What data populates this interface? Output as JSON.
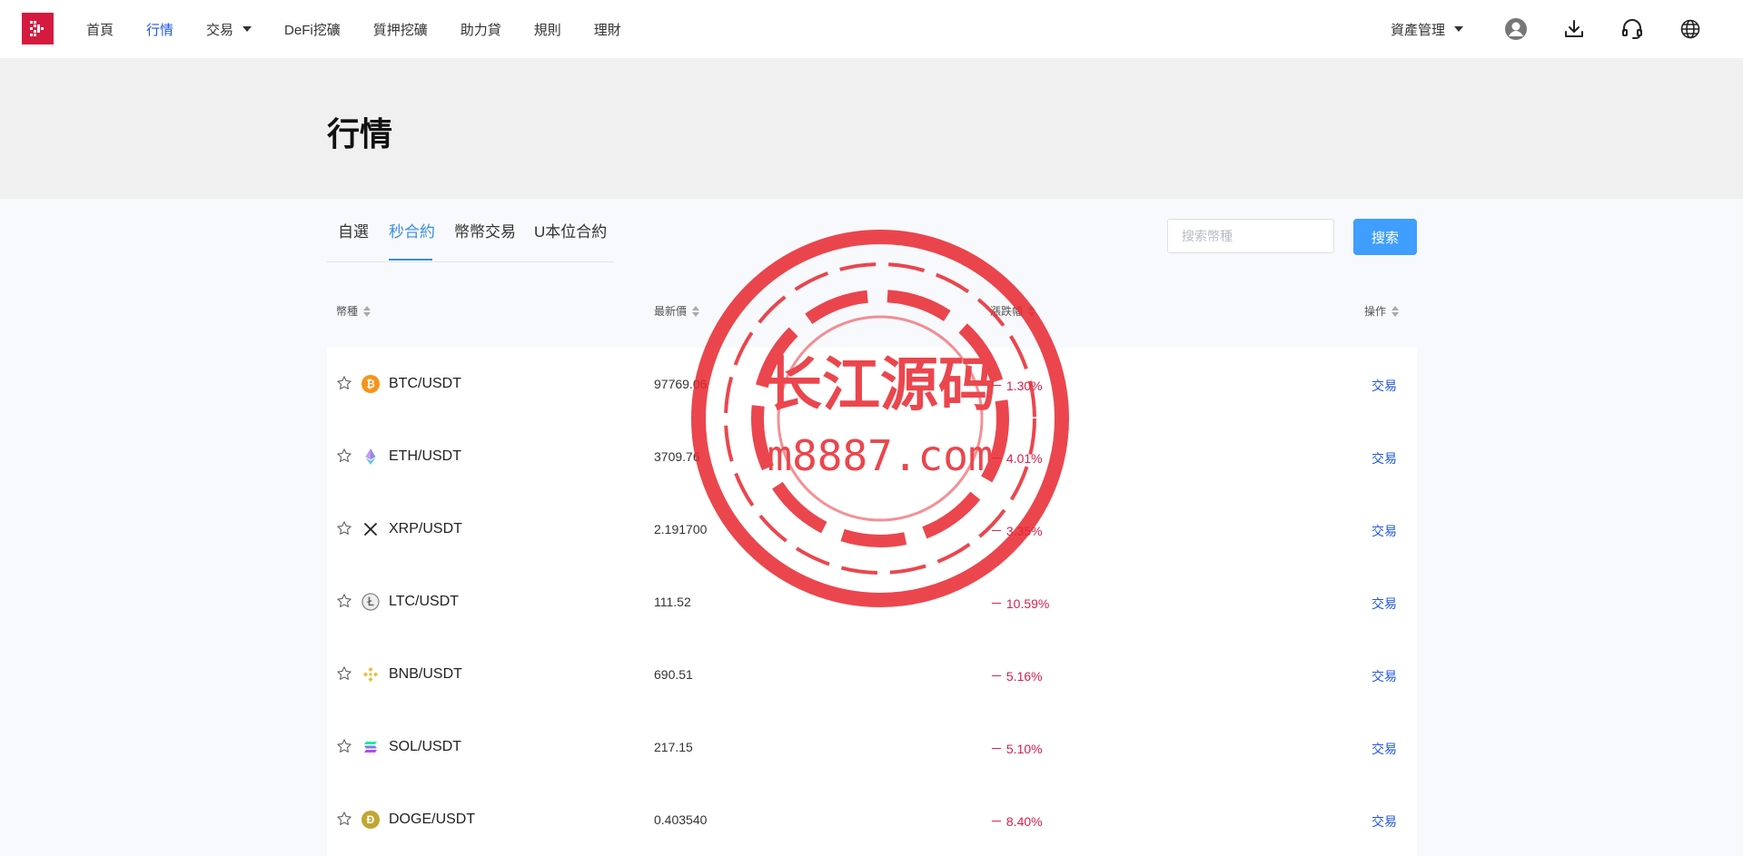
{
  "nav": {
    "items": [
      {
        "label": "首頁",
        "active": false,
        "dropdown": false
      },
      {
        "label": "行情",
        "active": true,
        "dropdown": false
      },
      {
        "label": "交易",
        "active": false,
        "dropdown": true
      },
      {
        "label": "DeFi挖礦",
        "active": false,
        "dropdown": false
      },
      {
        "label": "質押挖礦",
        "active": false,
        "dropdown": false
      },
      {
        "label": "助力貸",
        "active": false,
        "dropdown": false
      },
      {
        "label": "規則",
        "active": false,
        "dropdown": false
      },
      {
        "label": "理財",
        "active": false,
        "dropdown": false
      }
    ],
    "asset_menu": "資產管理",
    "icons": [
      "user-avatar-icon",
      "download-icon",
      "headset-icon",
      "globe-icon"
    ]
  },
  "page": {
    "title": "行情"
  },
  "tabs": [
    {
      "label": "自選",
      "active": false
    },
    {
      "label": "秒合約",
      "active": true
    },
    {
      "label": "幣幣交易",
      "active": false
    },
    {
      "label": "U本位合約",
      "active": false
    }
  ],
  "search": {
    "placeholder": "搜索幣種",
    "value": "",
    "button_label": "搜索"
  },
  "table": {
    "columns": [
      "幣種",
      "最新價",
      "漲跌幅",
      "操作"
    ],
    "rows": [
      {
        "pair": "BTC/USDT",
        "price": "97769.06",
        "change": "－ 1.30%",
        "action": "交易",
        "icon": "bitcoin-icon"
      },
      {
        "pair": "ETH/USDT",
        "price": "3709.76",
        "change": "－ 4.01%",
        "action": "交易",
        "icon": "ethereum-icon"
      },
      {
        "pair": "XRP/USDT",
        "price": "2.191700",
        "change": "－ 3.35%",
        "action": "交易",
        "icon": "xrp-icon"
      },
      {
        "pair": "LTC/USDT",
        "price": "111.52",
        "change": "－ 10.59%",
        "action": "交易",
        "icon": "litecoin-icon"
      },
      {
        "pair": "BNB/USDT",
        "price": "690.51",
        "change": "－ 5.16%",
        "action": "交易",
        "icon": "bnb-icon"
      },
      {
        "pair": "SOL/USDT",
        "price": "217.15",
        "change": "－ 5.10%",
        "action": "交易",
        "icon": "solana-icon"
      },
      {
        "pair": "DOGE/USDT",
        "price": "0.403540",
        "change": "－ 8.40%",
        "action": "交易",
        "icon": "dogecoin-icon"
      }
    ]
  },
  "watermark": {
    "line1": "长江源码",
    "line2": "m8887.com"
  },
  "colors": {
    "brand": "#d41b3f",
    "accent": "#2157e8",
    "tab_active": "#3a8ee6",
    "button": "#409eff",
    "negative": "#d8204c",
    "watermark": "#e8262f"
  }
}
